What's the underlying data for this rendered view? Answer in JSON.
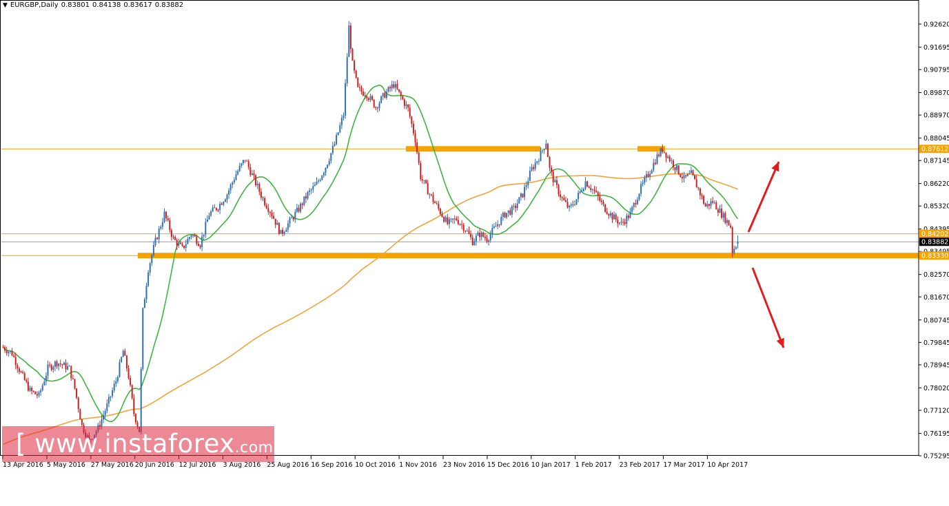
{
  "header": {
    "symbol_timeframe": "EURGBP,Daily",
    "open": "0.83801",
    "high": "0.84138",
    "low": "0.83617",
    "close": "0.83882"
  },
  "watermark": {
    "prefix": "[ www.",
    "brand": "instaforex",
    "suffix": ".com ]"
  },
  "colors": {
    "bull": "#2f6fb3",
    "bear": "#cc1f1f",
    "ma_fast": "#3fb33f",
    "ma_slow": "#f2a33a",
    "level": "#f5a300",
    "arrow": "#e31b1b"
  },
  "chart_data": {
    "type": "candlestick",
    "title": "EURGBP,Daily",
    "price_axis": {
      "ticks": [
        "0.92620",
        "0.91695",
        "0.90795",
        "0.89870",
        "0.88970",
        "0.88045",
        "0.87145",
        "0.86220",
        "0.85320",
        "0.84395",
        "0.83495",
        "0.82570",
        "0.81670",
        "0.80745",
        "0.79845",
        "0.78945",
        "0.78020",
        "0.77120",
        "0.76195",
        "0.75295"
      ],
      "range": [
        0.75295,
        0.9262
      ]
    },
    "time_axis": {
      "labels": [
        "13 Apr 2016",
        "5 May 2016",
        "27 May 2016",
        "20 Jun 2016",
        "12 Jul 2016",
        "3 Aug 2016",
        "25 Aug 2016",
        "16 Sep 2016",
        "10 Oct 2016",
        "1 Nov 2016",
        "23 Nov 2016",
        "15 Dec 2016",
        "10 Jan 2017",
        "1 Feb 2017",
        "23 Feb 2017",
        "17 Mar 2017",
        "10 Apr 2017"
      ]
    },
    "price_labels": [
      {
        "value": "0.87612",
        "price": 0.87612,
        "style": "level"
      },
      {
        "value": "0.84202",
        "price": 0.84202,
        "style": "level"
      },
      {
        "value": "0.83882",
        "price": 0.83882,
        "style": "current"
      },
      {
        "value": "0.83330",
        "price": 0.8333,
        "style": "level"
      }
    ],
    "horizontal_lines": [
      0.87612,
      0.84202,
      0.83882,
      0.8333
    ],
    "zones": [
      {
        "price": 0.8333,
        "from_date": "20 Jun 2016",
        "to_date": "end",
        "thick": true
      },
      {
        "price": 0.87612,
        "from_date": "1 Nov 2016",
        "to_date": "10 Jan 2017",
        "thick": true
      },
      {
        "price": 0.87612,
        "from_date": "23 Feb 2017",
        "to_date": "17 Mar 2017",
        "thick": true
      }
    ],
    "anchors": [
      [
        0,
        0.7965
      ],
      [
        5,
        0.794
      ],
      [
        10,
        0.786
      ],
      [
        15,
        0.779
      ],
      [
        20,
        0.777
      ],
      [
        25,
        0.788
      ],
      [
        30,
        0.7905
      ],
      [
        37,
        0.788
      ],
      [
        40,
        0.78
      ],
      [
        44,
        0.765
      ],
      [
        48,
        0.759
      ],
      [
        53,
        0.764
      ],
      [
        58,
        0.773
      ],
      [
        63,
        0.783
      ],
      [
        67,
        0.795
      ],
      [
        70,
        0.785
      ],
      [
        73,
        0.77
      ],
      [
        76,
        0.763
      ],
      [
        78,
        0.811
      ],
      [
        81,
        0.828
      ],
      [
        85,
        0.839
      ],
      [
        90,
        0.85
      ],
      [
        95,
        0.84
      ],
      [
        100,
        0.836
      ],
      [
        105,
        0.842
      ],
      [
        110,
        0.838
      ],
      [
        115,
        0.85
      ],
      [
        120,
        0.853
      ],
      [
        125,
        0.858
      ],
      [
        130,
        0.866
      ],
      [
        135,
        0.872
      ],
      [
        140,
        0.864
      ],
      [
        145,
        0.856
      ],
      [
        150,
        0.85
      ],
      [
        155,
        0.842
      ],
      [
        160,
        0.847
      ],
      [
        165,
        0.852
      ],
      [
        170,
        0.858
      ],
      [
        175,
        0.862
      ],
      [
        180,
        0.869
      ],
      [
        185,
        0.878
      ],
      [
        190,
        0.89
      ],
      [
        193,
        0.925
      ],
      [
        195,
        0.91
      ],
      [
        198,
        0.9
      ],
      [
        203,
        0.898
      ],
      [
        208,
        0.893
      ],
      [
        213,
        0.898
      ],
      [
        218,
        0.902
      ],
      [
        222,
        0.897
      ],
      [
        226,
        0.892
      ],
      [
        230,
        0.88
      ],
      [
        233,
        0.865
      ],
      [
        238,
        0.858
      ],
      [
        243,
        0.852
      ],
      [
        248,
        0.846
      ],
      [
        253,
        0.848
      ],
      [
        258,
        0.844
      ],
      [
        262,
        0.839
      ],
      [
        266,
        0.842
      ],
      [
        270,
        0.84
      ],
      [
        275,
        0.845
      ],
      [
        280,
        0.85
      ],
      [
        285,
        0.852
      ],
      [
        290,
        0.858
      ],
      [
        295,
        0.868
      ],
      [
        300,
        0.874
      ],
      [
        303,
        0.879
      ],
      [
        305,
        0.868
      ],
      [
        308,
        0.862
      ],
      [
        312,
        0.856
      ],
      [
        316,
        0.852
      ],
      [
        320,
        0.856
      ],
      [
        325,
        0.863
      ],
      [
        330,
        0.859
      ],
      [
        335,
        0.853
      ],
      [
        340,
        0.849
      ],
      [
        345,
        0.846
      ],
      [
        350,
        0.85
      ],
      [
        355,
        0.859
      ],
      [
        360,
        0.866
      ],
      [
        365,
        0.873
      ],
      [
        368,
        0.876
      ],
      [
        372,
        0.872
      ],
      [
        376,
        0.868
      ],
      [
        380,
        0.864
      ],
      [
        384,
        0.866
      ],
      [
        388,
        0.86
      ],
      [
        392,
        0.853
      ],
      [
        396,
        0.855
      ],
      [
        400,
        0.851
      ],
      [
        404,
        0.847
      ],
      [
        406,
        0.845
      ],
      [
        407,
        0.835
      ],
      [
        410,
        0.8388
      ]
    ]
  }
}
